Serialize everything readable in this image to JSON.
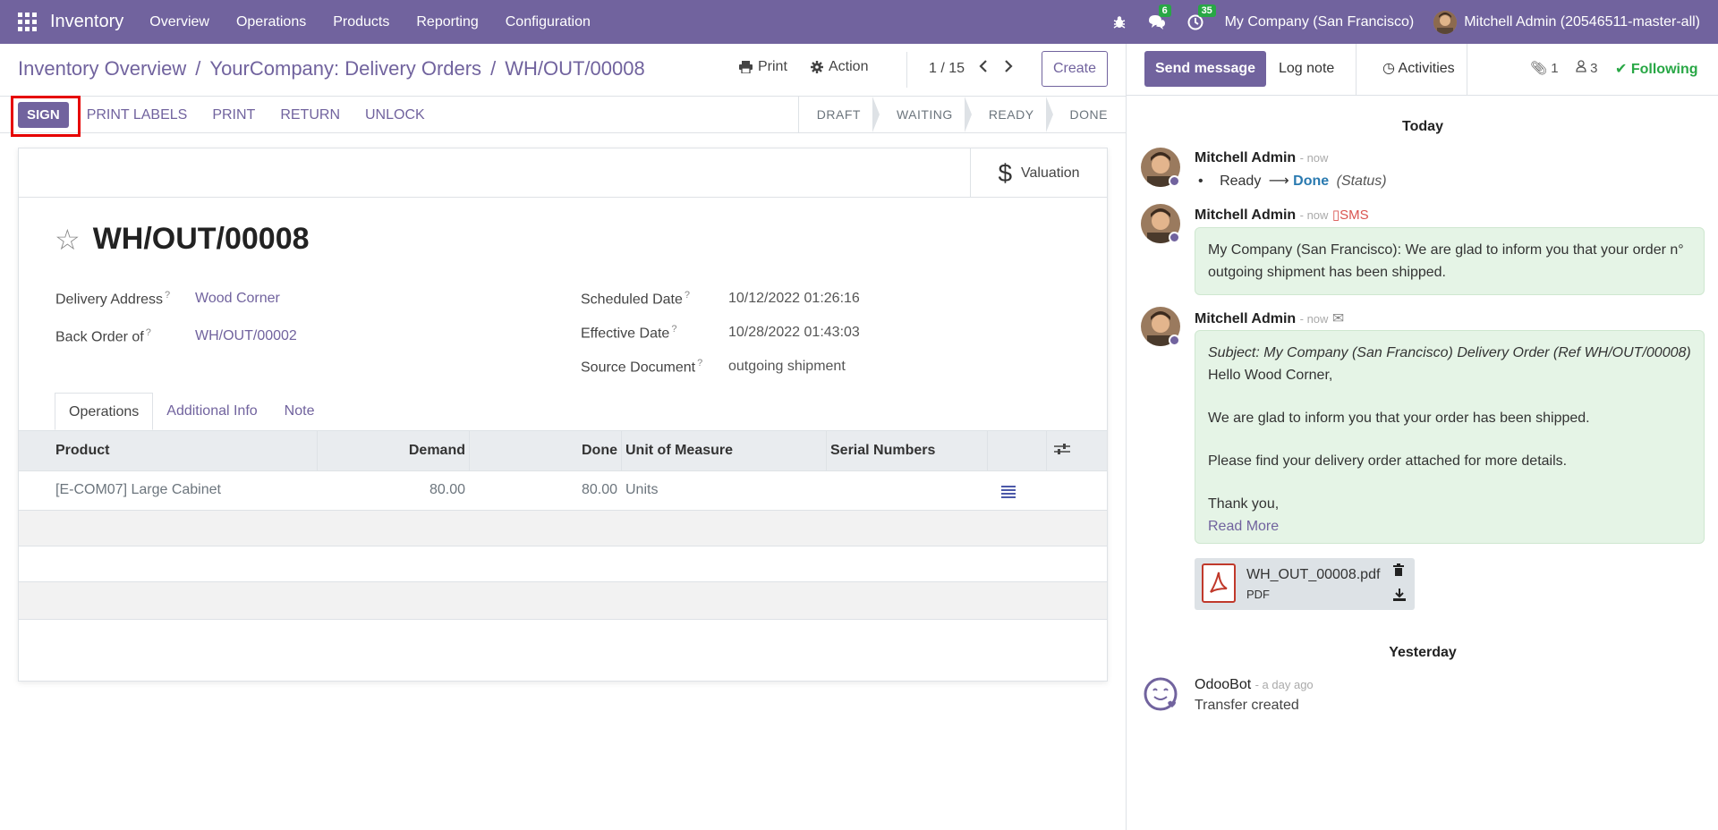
{
  "navbar": {
    "app_name": "Inventory",
    "menu": [
      "Overview",
      "Operations",
      "Products",
      "Reporting",
      "Configuration"
    ],
    "messages_badge": "6",
    "activities_badge": "35",
    "company": "My Company (San Francisco)",
    "user": "Mitchell Admin (20546511-master-all)"
  },
  "breadcrumb": {
    "items": [
      "Inventory Overview",
      "YourCompany: Delivery Orders",
      "WH/OUT/00008"
    ],
    "separator": "/"
  },
  "control": {
    "print_label": "Print",
    "action_label": "Action",
    "pager": "1 / 15",
    "create_label": "Create"
  },
  "statusbar": {
    "buttons": [
      "SIGN",
      "PRINT LABELS",
      "PRINT",
      "RETURN",
      "UNLOCK"
    ],
    "stages": [
      "DRAFT",
      "WAITING",
      "READY",
      "DONE"
    ]
  },
  "form": {
    "valuation_label": "Valuation",
    "title": "WH/OUT/00008",
    "fields": {
      "delivery_address_label": "Delivery Address",
      "delivery_address": "Wood Corner",
      "back_order_label": "Back Order of",
      "back_order": "WH/OUT/00002",
      "scheduled_date_label": "Scheduled Date",
      "scheduled_date": "10/12/2022 01:26:16",
      "effective_date_label": "Effective Date",
      "effective_date": "10/28/2022 01:43:03",
      "source_document_label": "Source Document",
      "source_document": "outgoing shipment",
      "help_mark": "?"
    },
    "tabs": [
      "Operations",
      "Additional Info",
      "Note"
    ],
    "table": {
      "headers": [
        "Product",
        "Demand",
        "Done",
        "Unit of Measure",
        "Serial Numbers"
      ],
      "rows": [
        {
          "product": "[E-COM07] Large Cabinet",
          "demand": "80.00",
          "done": "80.00",
          "uom": "Units"
        }
      ]
    }
  },
  "chatter": {
    "send_message": "Send message",
    "log_note": "Log note",
    "activities": "Activities",
    "attachments_count": "1",
    "followers_count": "3",
    "following": "Following",
    "today": "Today",
    "yesterday": "Yesterday",
    "messages": [
      {
        "author": "Mitchell Admin",
        "date": "- now",
        "tracking_from": "Ready",
        "tracking_to": "Done",
        "tracking_field": "(Status)"
      },
      {
        "author": "Mitchell Admin",
        "date": "- now",
        "channel": "SMS",
        "body": "My Company (San Francisco): We are glad to inform you that your order n° outgoing shipment has been shipped."
      },
      {
        "author": "Mitchell Admin",
        "date": "- now",
        "subject": "Subject: My Company (San Francisco) Delivery Order (Ref WH/OUT/00008)",
        "line1": "Hello Wood Corner,",
        "line2": "We are glad to inform you that your order has been shipped.",
        "line3": "Please find your delivery order attached for more details.",
        "line4": "Thank you,",
        "read_more": "Read More",
        "attachment_name": "WH_OUT_00008.pdf",
        "attachment_type": "PDF"
      },
      {
        "author": "OdooBot",
        "date": "- a day ago",
        "body": "Transfer created"
      }
    ]
  },
  "colors": {
    "brand": "#71639e",
    "success": "#28a745",
    "highlight": "#e60000"
  }
}
